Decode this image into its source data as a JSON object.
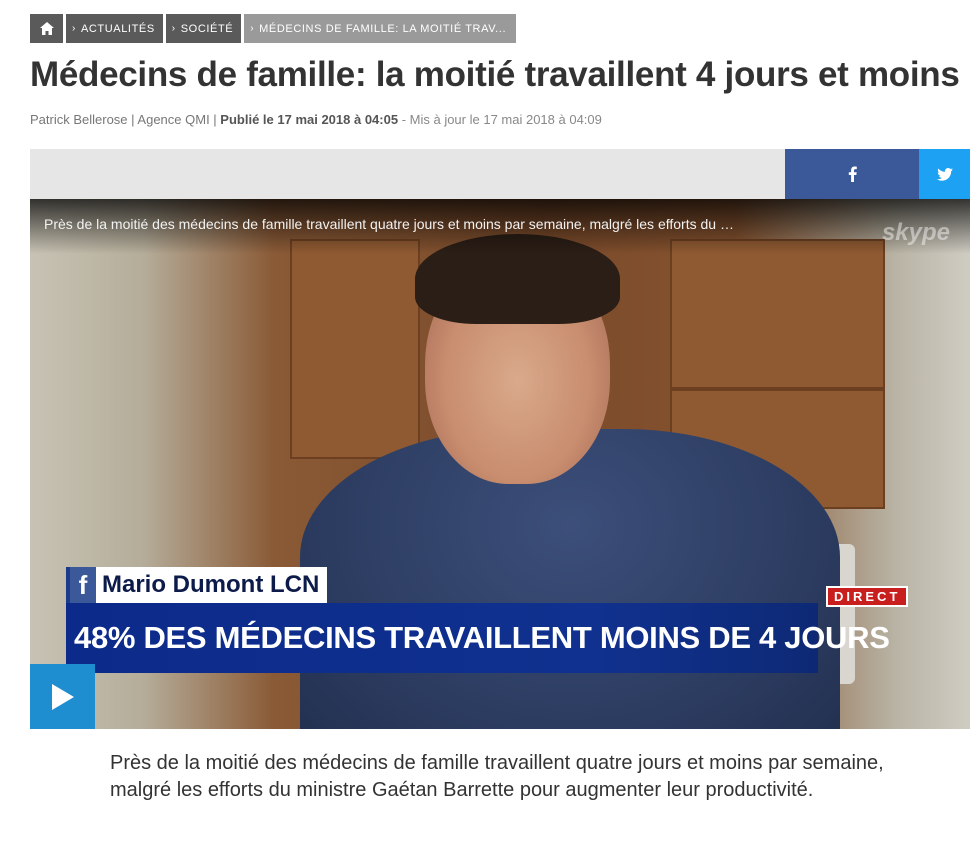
{
  "breadcrumb": {
    "home_icon": "home-icon",
    "items": [
      {
        "label": "ACTUALITÉS"
      },
      {
        "label": "SOCIÉTÉ"
      },
      {
        "label": "MÉDECINS DE FAMILLE: LA MOITIÉ TRAV..."
      }
    ]
  },
  "article": {
    "title": "Médecins de famille: la moitié travaillent 4 jours et moins",
    "byline": {
      "authors": "Patrick Bellerose | Agence QMI |",
      "published": "Publié le 17 mai 2018 à 04:05",
      "updated": "- Mis à jour le 17 mai 2018 à 04:09"
    },
    "lead": "Près de la moitié des médecins de famille travaillent quatre jours et moins par semaine, malgré les efforts du ministre Gaétan Barrette pour augmenter leur productivité."
  },
  "share": {
    "facebook_icon": "facebook-icon",
    "twitter_icon": "twitter-icon",
    "colors": {
      "facebook": "#3b5998",
      "twitter": "#1da1f2",
      "bar": "#e6e6e6"
    }
  },
  "video": {
    "caption": "Près de la moitié des médecins de famille travaillent quatre jours et moins par semaine, malgré les efforts du …",
    "watermark": "skype",
    "lower_third_name": "Mario Dumont LCN",
    "lower_third_headline": "48% DES MÉDECINS TRAVAILLENT MOINS DE 4 JOURS",
    "live_label": "DIRECT",
    "play_icon": "play-icon",
    "colors": {
      "play": "#1e8ed0",
      "headline_bg": "#0c2a8a",
      "live": "#c81e1e"
    }
  }
}
